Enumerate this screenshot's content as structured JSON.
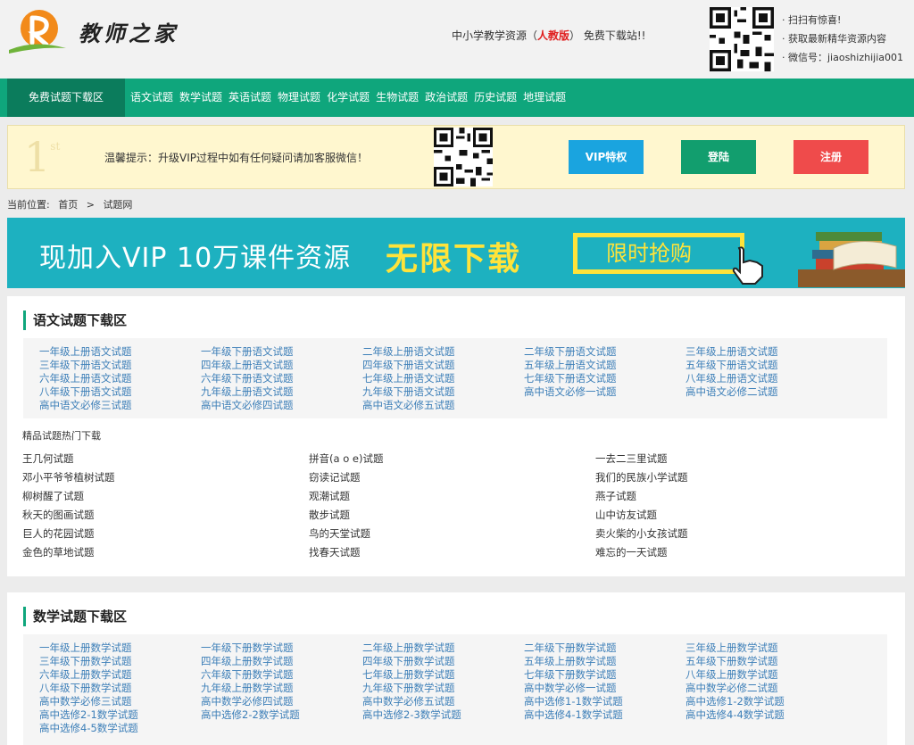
{
  "header": {
    "logo_text": "教师之家",
    "slogan_pre": "中小学教学资源（",
    "slogan_highlight": "人教版",
    "slogan_post": "） 免费下载站!!",
    "qr_notes": [
      "· 扫扫有惊喜!",
      "· 获取最新精华资源内容",
      "· 微信号：jiaoshizhijia001"
    ]
  },
  "nav": {
    "active": "免费试题下载区",
    "items": [
      "语文试题",
      "数学试题",
      "英语试题",
      "物理试题",
      "化学试题",
      "生物试题",
      "政治试题",
      "历史试题",
      "地理试题"
    ]
  },
  "notice": {
    "first_num": "1",
    "first_sup": "st",
    "tip": "温馨提示：升级VIP过程中如有任何疑问请加客服微信！",
    "vip_label": "VIP特权",
    "login_label": "登陆",
    "register_label": "注册"
  },
  "breadcrumb": {
    "prefix": "当前位置:",
    "home": "首页",
    "sep": ">",
    "current": "试题网"
  },
  "banner": {
    "text1": "现加入VIP 10万课件资源",
    "text2": "无限下载",
    "cta": "限时抢购"
  },
  "sections": [
    {
      "title": "语文试题下载区",
      "links": [
        "一年级上册语文试题",
        "一年级下册语文试题",
        "二年级上册语文试题",
        "二年级下册语文试题",
        "三年级上册语文试题",
        "三年级下册语文试题",
        "四年级上册语文试题",
        "四年级下册语文试题",
        "五年级上册语文试题",
        "五年级下册语文试题",
        "六年级上册语文试题",
        "六年级下册语文试题",
        "七年级上册语文试题",
        "七年级下册语文试题",
        "八年级上册语文试题",
        "八年级下册语文试题",
        "九年级上册语文试题",
        "九年级下册语文试题",
        "高中语文必修一试题",
        "高中语文必修二试题",
        "高中语文必修三试题",
        "高中语文必修四试题",
        "高中语文必修五试题"
      ],
      "hot_title": "精品试题热门下载",
      "hot": [
        "王几何试题",
        "拼音(a o e)试题",
        "一去二三里试题",
        "邓小平爷爷植树试题",
        "窃读记试题",
        "我们的民族小学试题",
        "柳树醒了试题",
        "观潮试题",
        "燕子试题",
        "秋天的图画试题",
        "散步试题",
        "山中访友试题",
        "巨人的花园试题",
        "鸟的天堂试题",
        "卖火柴的小女孩试题",
        "金色的草地试题",
        "找春天试题",
        "难忘的一天试题"
      ]
    },
    {
      "title": "数学试题下载区",
      "links": [
        "一年级上册数学试题",
        "一年级下册数学试题",
        "二年级上册数学试题",
        "二年级下册数学试题",
        "三年级上册数学试题",
        "三年级下册数学试题",
        "四年级上册数学试题",
        "四年级下册数学试题",
        "五年级上册数学试题",
        "五年级下册数学试题",
        "六年级上册数学试题",
        "六年级下册数学试题",
        "七年级上册数学试题",
        "七年级下册数学试题",
        "八年级上册数学试题",
        "八年级下册数学试题",
        "九年级上册数学试题",
        "九年级下册数学试题",
        "高中数学必修一试题",
        "高中数学必修二试题",
        "高中数学必修三试题",
        "高中数学必修四试题",
        "高中数学必修五试题",
        "高中选修1-1数学试题",
        "高中选修1-2数学试题",
        "高中选修2-1数学试题",
        "高中选修2-2数学试题",
        "高中选修2-3数学试题",
        "高中选修4-1数学试题",
        "高中选修4-4数学试题",
        "高中选修4-5数学试题"
      ]
    }
  ],
  "colors": {
    "nav_green": "#0fa67c",
    "nav_active": "#0b7c5c",
    "link_blue": "#3d7fb8",
    "vip_blue": "#1aa4df",
    "login_green": "#129e6e",
    "register_red": "#ef4b4b",
    "banner_cyan": "#1db1c0",
    "banner_yellow": "#ffe33a"
  }
}
